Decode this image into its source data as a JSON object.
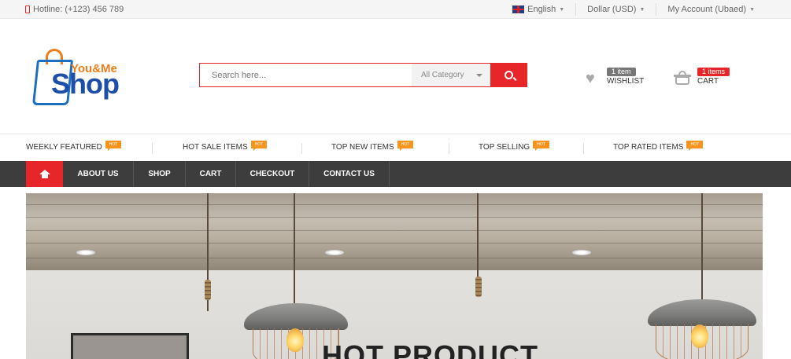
{
  "topbar": {
    "hotline": "Hotline: (+123) 456 789",
    "language": "English",
    "currency": "Dollar (USD)",
    "account": "My Account (Ubaed)"
  },
  "logo": {
    "top_text": "You&Me",
    "main_text": "Shop"
  },
  "search": {
    "placeholder": "Search here...",
    "category": "All Category"
  },
  "wishlist": {
    "count": "1 item",
    "label": "WISHLIST"
  },
  "cart": {
    "count": "1 items",
    "label": "CART"
  },
  "categories": [
    {
      "label": "WEEKLY FEATURED",
      "badge": "HOT"
    },
    {
      "label": "HOT SALE ITEMS",
      "badge": "HOT"
    },
    {
      "label": "TOP NEW ITEMS",
      "badge": "HOT"
    },
    {
      "label": "TOP SELLING",
      "badge": "HOT"
    },
    {
      "label": "TOP RATED ITEMS",
      "badge": "HOT"
    }
  ],
  "nav": {
    "items": [
      "ABOUT US",
      "SHOP",
      "CART",
      "CHECKOUT",
      "CONTACT US"
    ]
  },
  "hero": {
    "title": "HOT PRODUCT"
  },
  "colors": {
    "accent": "#e7262a",
    "nav_bg": "#3d3d3d",
    "hot_badge": "#f7941d",
    "logo_blue": "#1d4fa8",
    "logo_orange": "#f07d1a"
  },
  "icons": [
    "phone-icon",
    "flag-icon",
    "chevron-down-icon",
    "search-icon",
    "heart-icon",
    "basket-icon",
    "home-icon"
  ]
}
